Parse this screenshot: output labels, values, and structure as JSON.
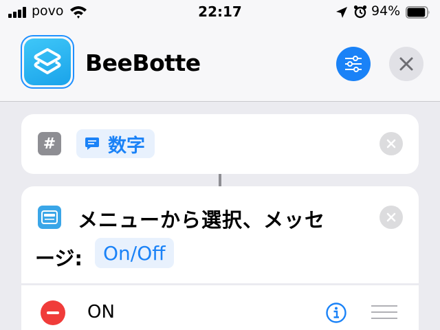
{
  "status_bar": {
    "carrier": "povo",
    "time": "22:17",
    "battery": "94%",
    "battery_level": 0.94,
    "icons": [
      "signal-icon",
      "wifi-icon",
      "location-arrow-icon",
      "alarm-icon",
      "battery-icon"
    ]
  },
  "header": {
    "title": "BeeBotte",
    "app_icon": "shortcuts-layers-icon",
    "settings_icon": "sliders-icon",
    "close_icon": "close-icon"
  },
  "actions": [
    {
      "icon": "number-hash-icon",
      "variable_icon": "message-bubble-icon",
      "variable_label": "数字"
    },
    {
      "icon": "choose-from-menu-icon",
      "text_line1": "メニューから選択、メッセ",
      "text_line2": "ージ:",
      "parameter": "On/Off",
      "options": [
        {
          "label": "ON"
        }
      ]
    }
  ],
  "colors": {
    "accent": "#1a82f7",
    "destructive": "#f03c3a",
    "background": "#ebebf0"
  }
}
